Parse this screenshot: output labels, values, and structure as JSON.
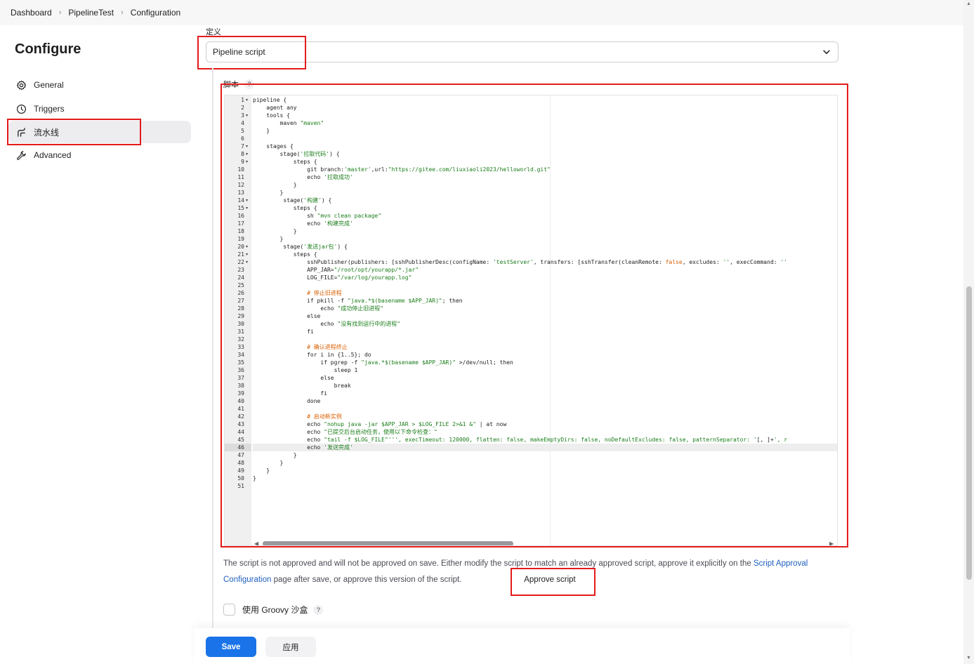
{
  "breadcrumb": {
    "items": [
      "Dashboard",
      "PipelineTest",
      "Configuration"
    ]
  },
  "page": {
    "title": "Configure"
  },
  "sidebar": {
    "items": [
      {
        "label": "General",
        "icon": "gear-icon"
      },
      {
        "label": "Triggers",
        "icon": "clock-icon"
      },
      {
        "label": "流水线",
        "icon": "pipeline-icon",
        "active": true
      },
      {
        "label": "Advanced",
        "icon": "wrench-icon"
      }
    ]
  },
  "definition": {
    "label": "定义",
    "selected": "Pipeline script"
  },
  "script": {
    "label": "脚本",
    "help": "?",
    "line_numbers": [
      "1",
      "2",
      "3",
      "4",
      "5",
      "6",
      "7",
      "8",
      "9",
      "10",
      "11",
      "12",
      "13",
      "14",
      "15",
      "16",
      "17",
      "18",
      "19",
      "20",
      "21",
      "22",
      "23",
      "24",
      "25",
      "26",
      "27",
      "28",
      "29",
      "30",
      "31",
      "32",
      "33",
      "34",
      "35",
      "36",
      "37",
      "38",
      "39",
      "40",
      "41",
      "42",
      "43",
      "44",
      "45",
      "46",
      "47",
      "48",
      "49",
      "50",
      "51"
    ],
    "active_line": 46,
    "lines": [
      "pipeline {",
      "    agent any",
      "    tools {",
      "        maven \"maven\"",
      "    }",
      "",
      "    stages {",
      "        stage('拉取代码') {",
      "            steps {",
      "                git branch:'master',url:\"https://gitee.com/liuxiaoli2023/helloworld.git\"",
      "                echo '拉取成功'",
      "            }",
      "        }",
      "         stage('构建') {",
      "            steps {",
      "                sh \"mvn clean package\"",
      "                echo '构建完成'",
      "            }",
      "        }",
      "         stage('发送jar包') {",
      "            steps {",
      "                sshPublisher(publishers: [sshPublisherDesc(configName: 'testServer', transfers: [sshTransfer(cleanRemote: false, excludes: '', execCommand: ''",
      "                APP_JAR=\"/root/opt/yourapp/*.jar\"",
      "                LOG_FILE=\"/var/log/yourapp.log\"",
      "",
      "                # 停止旧进程",
      "                if pkill -f \"java.*$(basename $APP_JAR)\"; then",
      "                    echo \"成功停止旧进程\"",
      "                else",
      "                    echo \"没有找到运行中的进程\"",
      "                fi",
      "",
      "                # 确认进程终止",
      "                for i in {1..5}; do",
      "                    if pgrep -f \"java.*$(basename $APP_JAR)\" >/dev/null; then",
      "                        sleep 1",
      "                    else",
      "                        break",
      "                    fi",
      "                done",
      "",
      "                # 启动新实例",
      "                echo \"nohup java -jar $APP_JAR > $LOG_FILE 2>&1 &\" | at now",
      "                echo \"已提交后台启动任务，使用以下命令检查：\"",
      "                echo \"tail -f $LOG_FILE\"''', execTimeout: 120000, flatten: false, makeEmptyDirs: false, noDefaultExcludes: false, patternSeparator: '[, ]+', r",
      "                echo '发送完成'",
      "            }",
      "        }",
      "    }",
      "}",
      ""
    ]
  },
  "approval": {
    "text_before": "The script is not approved and will not be approved on save. Either modify the script to match an already approved script, approve it explicitly on the ",
    "link": "Script Approval Configuration",
    "text_after": " page after save, or approve this version of the script.",
    "button": "Approve script"
  },
  "groovy": {
    "label": "使用 Groovy 沙盒",
    "help": "?",
    "checked": false
  },
  "buttons": {
    "save": "Save",
    "apply": "应用"
  },
  "colors": {
    "primary": "#1a73e8",
    "highlight": "#e41a1c",
    "string": "#1a7d1a",
    "keyword_value": "#d95f02"
  }
}
